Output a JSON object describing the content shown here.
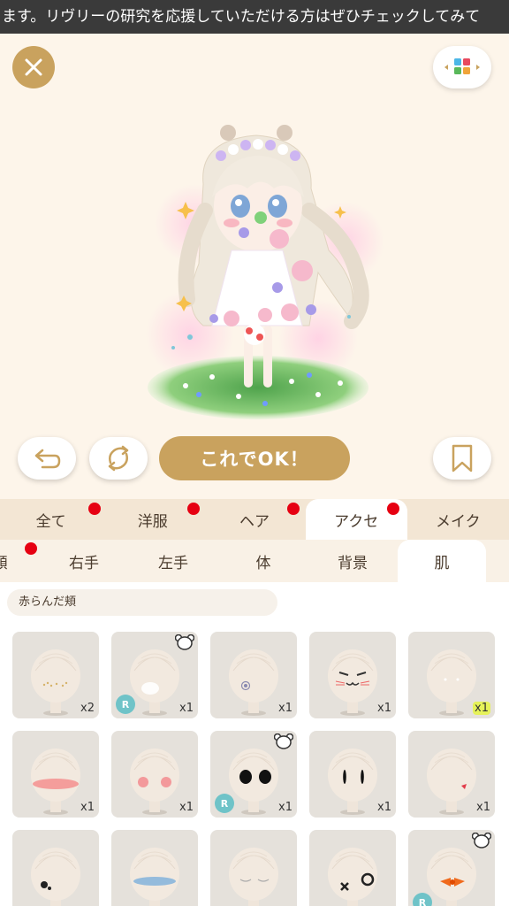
{
  "ticker": {
    "text": "ます。リヴリーの研究を応援していただける方はぜひチェックしてみて"
  },
  "stage": {
    "close_icon": "close-icon",
    "style_icon": "color-swatch-icon",
    "undo_icon": "undo-icon",
    "random_icon": "refresh-icon",
    "bookmark_icon": "bookmark-icon",
    "ok_label": "これでOK！"
  },
  "categories": [
    {
      "label": "全て",
      "badge": true
    },
    {
      "label": "洋服",
      "badge": true
    },
    {
      "label": "ヘア",
      "badge": true
    },
    {
      "label": "アクセ",
      "badge": true,
      "active": true
    },
    {
      "label": "メイク",
      "badge": false
    }
  ],
  "subcategories": [
    {
      "label": "顔",
      "badge": true
    },
    {
      "label": "右手"
    },
    {
      "label": "左手"
    },
    {
      "label": "体"
    },
    {
      "label": "背景"
    },
    {
      "label": "肌",
      "active": true
    }
  ],
  "section": {
    "label": "赤らんだ頬"
  },
  "items": [
    {
      "count": "x2",
      "feature": "freckles"
    },
    {
      "count": "x1",
      "feature": "white-blush",
      "rare": "R",
      "bear": true
    },
    {
      "count": "x1",
      "feature": "cheek-mark"
    },
    {
      "count": "x1",
      "feature": "cat-face"
    },
    {
      "count": "x1",
      "feature": "sparkle-cheeks",
      "highlight": true
    },
    {
      "count": "x1",
      "feature": "red-blush-band"
    },
    {
      "count": "x1",
      "feature": "pink-blush"
    },
    {
      "count": "x1",
      "feature": "black-eyes",
      "rare": "R",
      "bear": true
    },
    {
      "count": "x1",
      "feature": "slit-eyes"
    },
    {
      "count": "x1",
      "feature": "blood-mark"
    },
    {
      "count": "",
      "feature": "ink-spot"
    },
    {
      "count": "",
      "feature": "blue-band"
    },
    {
      "count": "",
      "feature": "sleepy-lines"
    },
    {
      "count": "",
      "feature": "x-mark"
    },
    {
      "count": "",
      "feature": "orange-bow",
      "rare": "R",
      "bear": true
    }
  ],
  "labels": {
    "rare": "R"
  },
  "colors": {
    "accent_gold": "#c9a25e",
    "badge_red": "#e60012",
    "rare_teal": "#6fc3c8",
    "highlight_yellow": "#e6f25a"
  }
}
